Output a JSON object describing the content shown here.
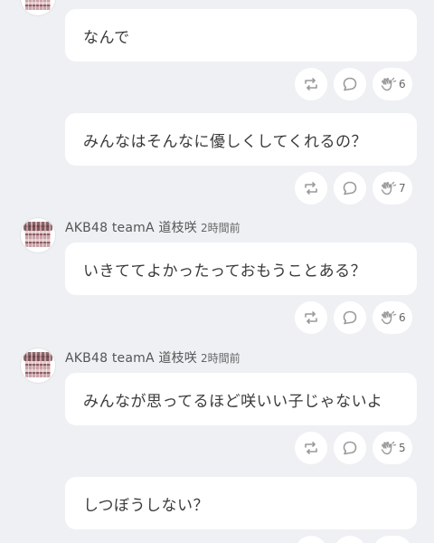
{
  "posts": [
    {
      "message": "なんで",
      "clap_count": "6"
    },
    {
      "message": "みんなはそんなに優しくしてくれるの？",
      "clap_count": "7"
    },
    {
      "author": "AKB48 teamA 道枝咲",
      "time": "2時間前",
      "message": "いきててよかったっておもうことある？",
      "clap_count": "6"
    },
    {
      "author": "AKB48 teamA 道枝咲",
      "time": "2時間前",
      "message": "みんなが思ってるほど咲いい子じゃないよ",
      "clap_count": "5"
    },
    {
      "message": "しつぼうしない？"
    }
  ],
  "icons": {
    "retweet": "retweet-icon",
    "comment": "comment-icon",
    "clap": "clap-icon"
  },
  "colors": {
    "background": "#eef0f3",
    "bubble": "#ffffff",
    "icon": "#9a9a9a"
  }
}
